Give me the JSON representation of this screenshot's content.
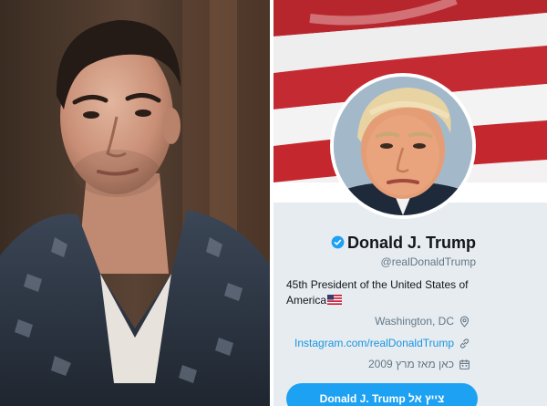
{
  "profile": {
    "display_name": "Donald J. Trump",
    "handle": "@realDonaldTrump",
    "bio": "45th President of the United States of America",
    "location": "Washington, DC",
    "website": "Instagram.com/realDonaldTrump",
    "joined": "כאן מאז מרץ 2009",
    "follow_button_label": "צייץ אל Donald J. Trump"
  },
  "icons": {
    "verified": "verified-badge-icon",
    "flag": "us-flag-icon",
    "location": "map-pin-icon",
    "website": "link-icon",
    "joined": "calendar-icon"
  },
  "colors": {
    "accent": "#1da1f2",
    "link": "#1b95e0",
    "muted_text": "#657786",
    "panel_background": "#e6ecf0"
  }
}
